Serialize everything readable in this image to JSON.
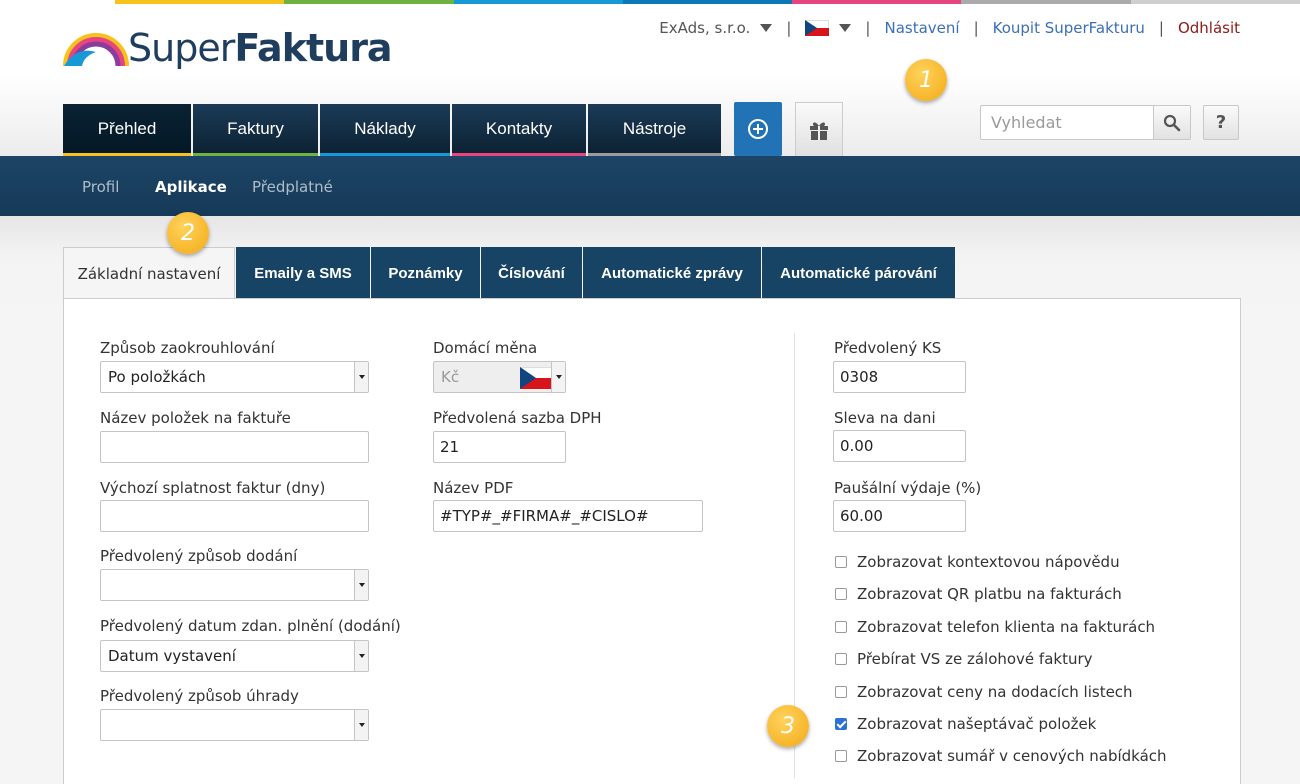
{
  "colors": {
    "stripe": [
      "#f8c21d",
      "#6fb23f",
      "#1699d5",
      "#0c78b8",
      "#e6457f",
      "#999999",
      "#c9c9c9"
    ],
    "tab_underlines": [
      "#f8c21d",
      "#6fb23f",
      "#1699d5",
      "#e6457f",
      "#9b9b9b"
    ]
  },
  "logo": {
    "text_light": "Super",
    "text_bold": "Faktura"
  },
  "topnav": {
    "company": "ExAds, s.r.o.",
    "language_icon": "czech-flag-icon",
    "sep": "|",
    "settings": "Nastavení",
    "buy": "Koupit SuperFakturu",
    "logout": "Odhlásit"
  },
  "badges": {
    "one": "1",
    "two": "2",
    "three": "3"
  },
  "maintabs": [
    {
      "label": "Přehled"
    },
    {
      "label": "Faktury"
    },
    {
      "label": "Náklady"
    },
    {
      "label": "Kontakty"
    },
    {
      "label": "Nástroje"
    }
  ],
  "actions": {
    "add_icon": "plus-circle-icon",
    "gift_icon": "gift-icon"
  },
  "search": {
    "placeholder": "Vyhledat",
    "icon": "search-icon"
  },
  "help": {
    "label": "?"
  },
  "subnav": [
    {
      "label": "Profil"
    },
    {
      "label": "Aplikace"
    },
    {
      "label": "Předplatné"
    }
  ],
  "settings_tabs": [
    {
      "label": "Základní nastavení"
    },
    {
      "label": "Emaily a SMS"
    },
    {
      "label": "Poznámky"
    },
    {
      "label": "Číslování"
    },
    {
      "label": "Automatické zprávy"
    },
    {
      "label": "Automatické párování"
    }
  ],
  "form": {
    "rounding": {
      "label": "Způsob zaokrouhlování",
      "value": "Po položkách"
    },
    "item_name": {
      "label": "Název položek na faktuře",
      "value": ""
    },
    "due": {
      "label": "Výchozí splatnost faktur (dny)",
      "value": ""
    },
    "delivery": {
      "label": "Předvolený způsob dodání",
      "value": ""
    },
    "tax_date": {
      "label": "Předvolený datum zdan. plnění (dodání)",
      "value": "Datum vystavení"
    },
    "payment": {
      "label": "Předvolený způsob úhrady",
      "value": ""
    },
    "currency": {
      "label": "Domácí měna",
      "value": "Kč"
    },
    "vat": {
      "label": "Předvolená sazba DPH",
      "value": "21"
    },
    "pdf_name": {
      "label": "Název PDF",
      "value": "#TYP#_#FIRMA#_#CISLO#"
    },
    "ks": {
      "label": "Předvolený KS",
      "value": "0308"
    },
    "tax_discount": {
      "label": "Sleva na dani",
      "value": "0.00"
    },
    "flat_expense": {
      "label": "Paušální výdaje (%)",
      "value": "60.00"
    }
  },
  "checkboxes": [
    {
      "label": "Zobrazovat kontextovou nápovědu",
      "checked": false
    },
    {
      "label": "Zobrazovat QR platbu na fakturách",
      "checked": false
    },
    {
      "label": "Zobrazovat telefon klienta na fakturách",
      "checked": false
    },
    {
      "label": "Přebírat VS ze zálohové faktury",
      "checked": false
    },
    {
      "label": "Zobrazovat ceny na dodacích listech",
      "checked": false
    },
    {
      "label": "Zobrazovat našeptávač položek",
      "checked": true
    },
    {
      "label": "Zobrazovat sumář v cenových nabídkách",
      "checked": false
    }
  ]
}
